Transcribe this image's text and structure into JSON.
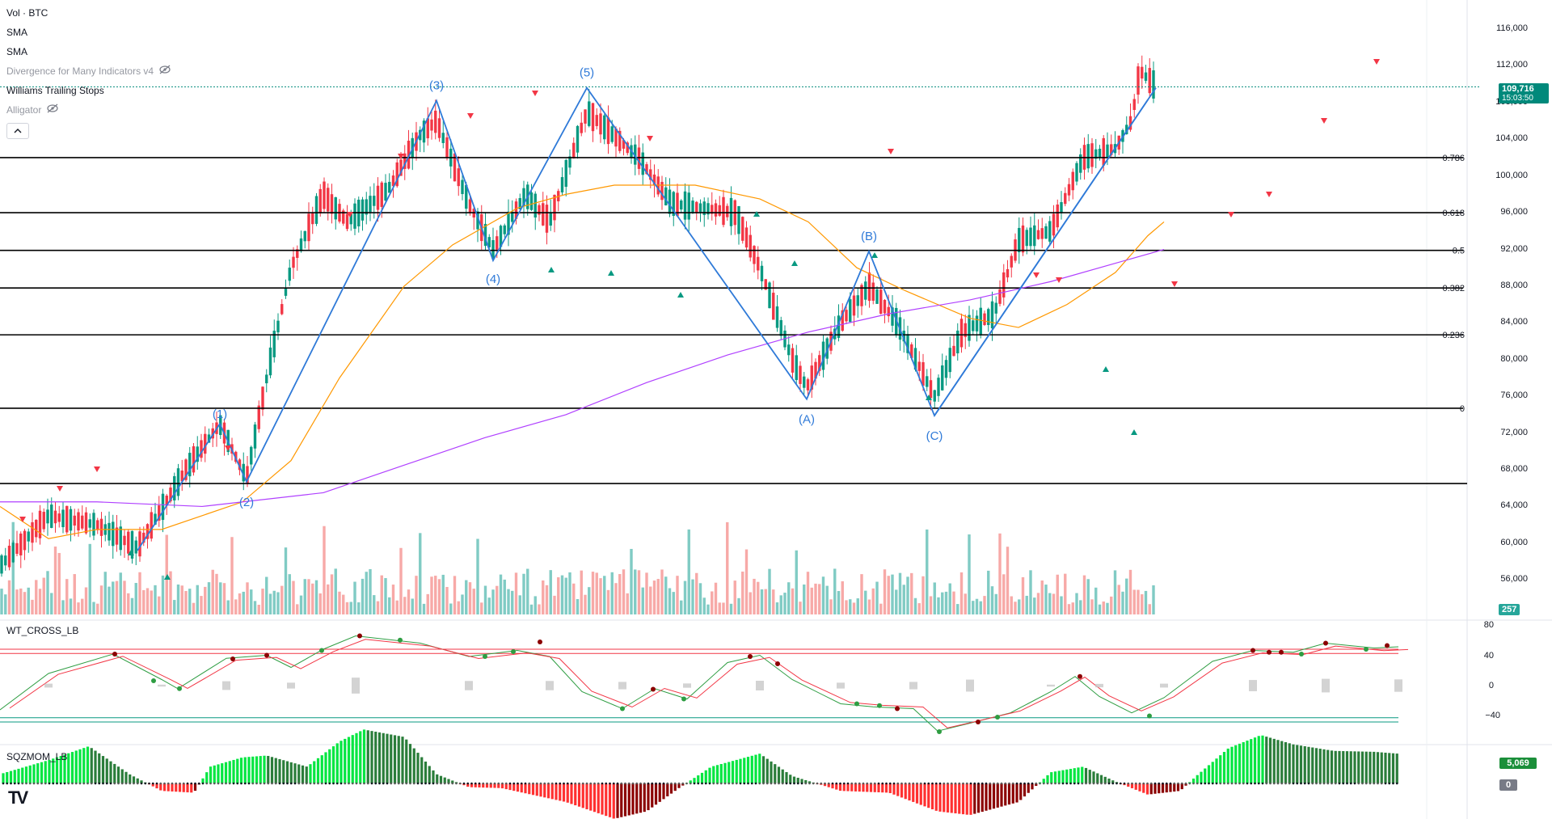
{
  "legend": {
    "items": [
      {
        "label": "Vol · BTC",
        "visible": true
      },
      {
        "label": "SMA",
        "visible": true
      },
      {
        "label": "SMA",
        "visible": true
      },
      {
        "label": "Divergence for Many Indicators v4",
        "visible": false
      },
      {
        "label": "Williams Trailing Stops",
        "visible": true
      },
      {
        "label": "Alligator",
        "visible": false
      }
    ],
    "collapse_icon": "chevron-up-icon",
    "hidden_icon": "eye-off-icon"
  },
  "price_axis": {
    "ticks": [
      "116,000",
      "112,000",
      "108,000",
      "104,000",
      "100,000",
      "96,000",
      "92,000",
      "88,000",
      "84,000",
      "80,000",
      "76,000",
      "72,000",
      "68,000",
      "64,000",
      "60,000",
      "56,000"
    ],
    "current_price": "109,716",
    "countdown": "15:03:50",
    "volume_tag": "257",
    "current_price_color": "#00897b"
  },
  "fib_levels": [
    {
      "label": "0.786",
      "price": 102000
    },
    {
      "label": "0.618",
      "price": 96000
    },
    {
      "label": "0.5",
      "price": 91900
    },
    {
      "label": "0.382",
      "price": 87800
    },
    {
      "label": "0.236",
      "price": 82700
    },
    {
      "label": "0",
      "price": 74700
    }
  ],
  "extra_line_price": 66500,
  "elliott_labels": [
    "(1)",
    "(2)",
    "(3)",
    "(4)",
    "(5)",
    "(A)",
    "(B)",
    "(C)"
  ],
  "wt_cross": {
    "title": "WT_CROSS_LB",
    "ticks": [
      "80",
      "40",
      "0",
      "−40"
    ]
  },
  "sqzmom": {
    "title": "SQZMOM_LB",
    "value": "5,069",
    "zero": "0",
    "value_color": "#1b8f3a"
  },
  "logo": "TV",
  "colors": {
    "up": "#089981",
    "down": "#f23645",
    "fib": "#000000",
    "wave": "#2962ff",
    "sma_fast": "#ff9800",
    "sma_slow": "#b040ff",
    "vol_up": "#80cbc4",
    "vol_down": "#f7a9a7"
  }
}
